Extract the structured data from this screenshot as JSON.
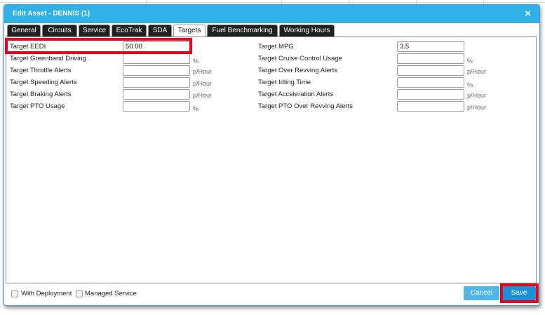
{
  "dialog": {
    "title": "Edit Asset - DENNIS (1)",
    "close_icon": "×"
  },
  "tabs": [
    {
      "label": "General"
    },
    {
      "label": "Circuits"
    },
    {
      "label": "Service"
    },
    {
      "label": "EcoTrak"
    },
    {
      "label": "SDA"
    },
    {
      "label": "Targets",
      "active": true
    },
    {
      "label": "Fuel Benchmarking"
    },
    {
      "label": "Working Hours"
    }
  ],
  "targets_left": [
    {
      "label": "Target EEDI",
      "value": "50.00",
      "unit": ""
    },
    {
      "label": "Target Greenband Driving",
      "value": "",
      "unit": "%"
    },
    {
      "label": "Target Throttle Alerts",
      "value": "",
      "unit": "p/Hour"
    },
    {
      "label": "Target Speeding Alerts",
      "value": "",
      "unit": "p/Hour"
    },
    {
      "label": "Target Braking Alerts",
      "value": "",
      "unit": "p/Hour"
    },
    {
      "label": "Target PTO Usage",
      "value": "",
      "unit": "%"
    }
  ],
  "targets_right": [
    {
      "label": "Target MPG",
      "value": "3.5",
      "unit": ""
    },
    {
      "label": "Target Cruise Control Usage",
      "value": "",
      "unit": "%"
    },
    {
      "label": "Target Over Revving Alerts",
      "value": "",
      "unit": "p/Hour"
    },
    {
      "label": "Target Idling Time",
      "value": "",
      "unit": "%"
    },
    {
      "label": "Target Acceleration Alerts",
      "value": "",
      "unit": "p/Hour"
    },
    {
      "label": "Target PTO Over Revving Alerts",
      "value": "",
      "unit": "p/Hour"
    }
  ],
  "footer": {
    "with_deployment_label": "With Deployment",
    "managed_service_label": "Managed Service",
    "cancel_label": "Cancel",
    "save_label": "Save"
  },
  "colors": {
    "titlebar": "#2fb0e6",
    "highlight": "#e8001c",
    "save_button": "#1e8fd6",
    "cancel_button": "#4fb6e6"
  }
}
